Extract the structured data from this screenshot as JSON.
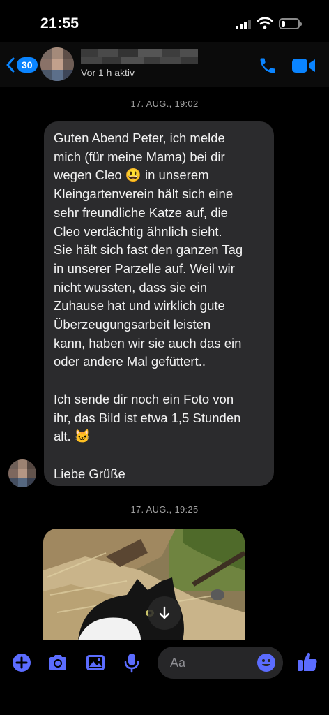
{
  "status_bar": {
    "time": "21:55"
  },
  "header": {
    "back_count": "30",
    "status": "Vor 1 h aktiv"
  },
  "messages": [
    {
      "timestamp": "17. AUG., 19:02",
      "paragraphs": [
        [
          "Guten Abend Peter, ich melde",
          "mich (für meine Mama) bei dir",
          "wegen Cleo 😃 in unserem",
          "Kleingartenverein hält sich eine",
          "sehr freundliche Katze auf, die",
          "Cleo verdächtig ähnlich sieht.",
          "Sie hält sich fast den ganzen Tag",
          "in unserer Parzelle auf. Weil wir",
          "nicht wussten, dass sie ein",
          "Zuhause hat und wirklich gute",
          "Überzeugungsarbeit leisten",
          "kann, haben wir sie auch das ein",
          "oder andere Mal gefüttert.."
        ],
        [
          "Ich sende dir noch ein Foto von",
          "ihr, das Bild ist etwa 1,5 Stunden",
          "alt. 🐱"
        ],
        [
          "Liebe Grüße"
        ]
      ]
    },
    {
      "timestamp": "17. AUG., 19:25"
    }
  ],
  "composer": {
    "placeholder": "Aa"
  },
  "colors": {
    "accent": "#0a84ff",
    "composer_icons": "#5b6cff",
    "bubble": "#2b2b2d"
  },
  "icons": [
    "back-chevron-icon",
    "phone-icon",
    "video-camera-icon",
    "download-arrow-icon",
    "plus-icon",
    "camera-icon",
    "image-icon",
    "microphone-icon",
    "emoji-icon",
    "thumbs-up-icon"
  ]
}
